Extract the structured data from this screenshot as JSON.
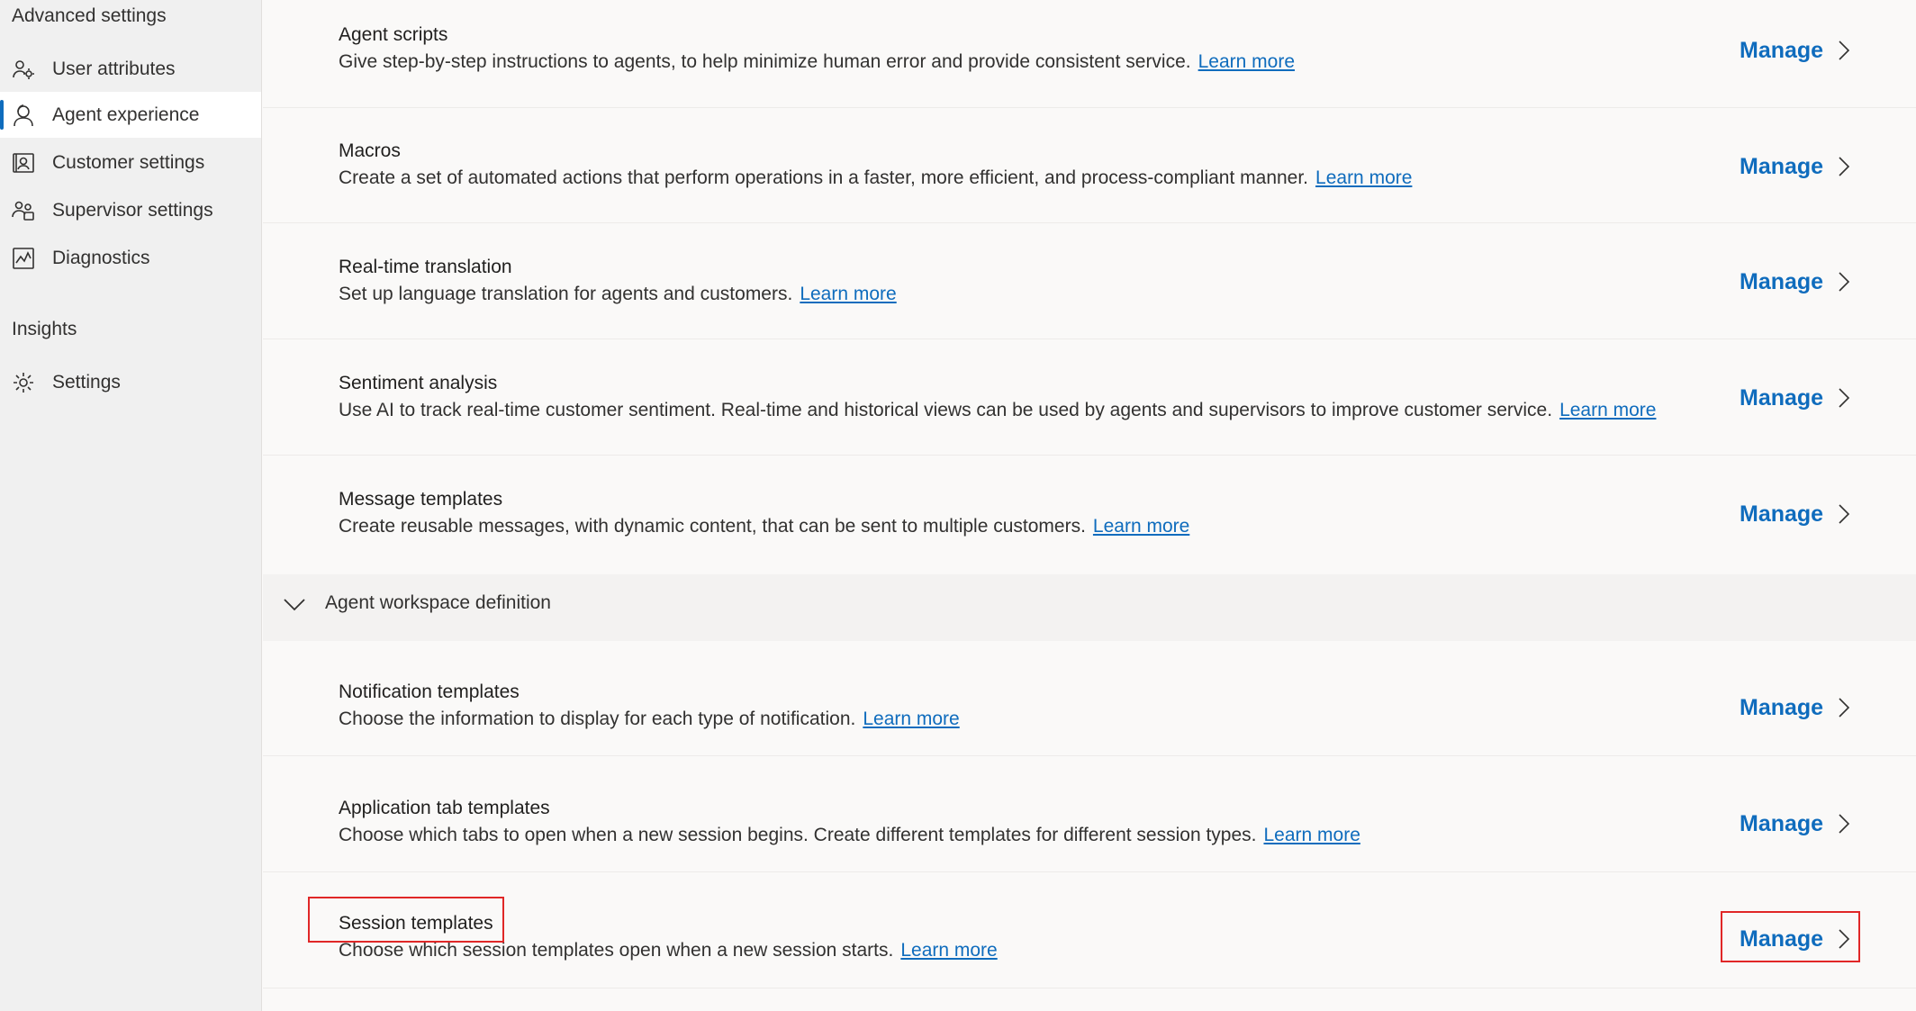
{
  "sidebar": {
    "advanced_heading": "Advanced settings",
    "items": [
      {
        "label": "User attributes",
        "icon": "user-attributes-icon"
      },
      {
        "label": "Agent experience",
        "icon": "agent-icon",
        "selected": true
      },
      {
        "label": "Customer settings",
        "icon": "contact-card-icon"
      },
      {
        "label": "Supervisor settings",
        "icon": "people-team-icon"
      },
      {
        "label": "Diagnostics",
        "icon": "chart-icon"
      }
    ],
    "insights_heading": "Insights",
    "insights_items": [
      {
        "label": "Settings",
        "icon": "gear-icon"
      }
    ]
  },
  "main": {
    "rows": [
      {
        "title": "Agent scripts",
        "description": "Give step-by-step instructions to agents, to help minimize human error and provide consistent service.",
        "link": "Learn more",
        "action": "Manage"
      },
      {
        "title": "Macros",
        "description": "Create a set of automated actions that perform operations in a faster, more efficient, and process-compliant manner.",
        "link": "Learn more",
        "action": "Manage"
      },
      {
        "title": "Real-time translation",
        "description": "Set up language translation for agents and customers.",
        "link": "Learn more",
        "action": "Manage"
      },
      {
        "title": "Sentiment analysis",
        "description": "Use AI to track real-time customer sentiment. Real-time and historical views can be used by agents and supervisors to improve customer service.",
        "link": "Learn more",
        "action": "Manage"
      },
      {
        "title": "Message templates",
        "description": "Create reusable messages, with dynamic content, that can be sent to multiple customers.",
        "link": "Learn more",
        "action": "Manage"
      }
    ],
    "section": {
      "title": "Agent workspace definition",
      "rows": [
        {
          "title": "Notification templates",
          "description": "Choose the information to display for each type of notification.",
          "link": "Learn more",
          "action": "Manage"
        },
        {
          "title": "Application tab templates",
          "description": "Choose which tabs to open when a new session begins. Create different templates for different session types.",
          "link": "Learn more",
          "action": "Manage"
        },
        {
          "title": "Session templates",
          "description": "Choose which session templates open when a new session starts.",
          "link": "Learn more",
          "action": "Manage",
          "highlighted": true
        }
      ]
    }
  },
  "colors": {
    "accent": "#0f6cbd",
    "highlight": "#e02727"
  }
}
